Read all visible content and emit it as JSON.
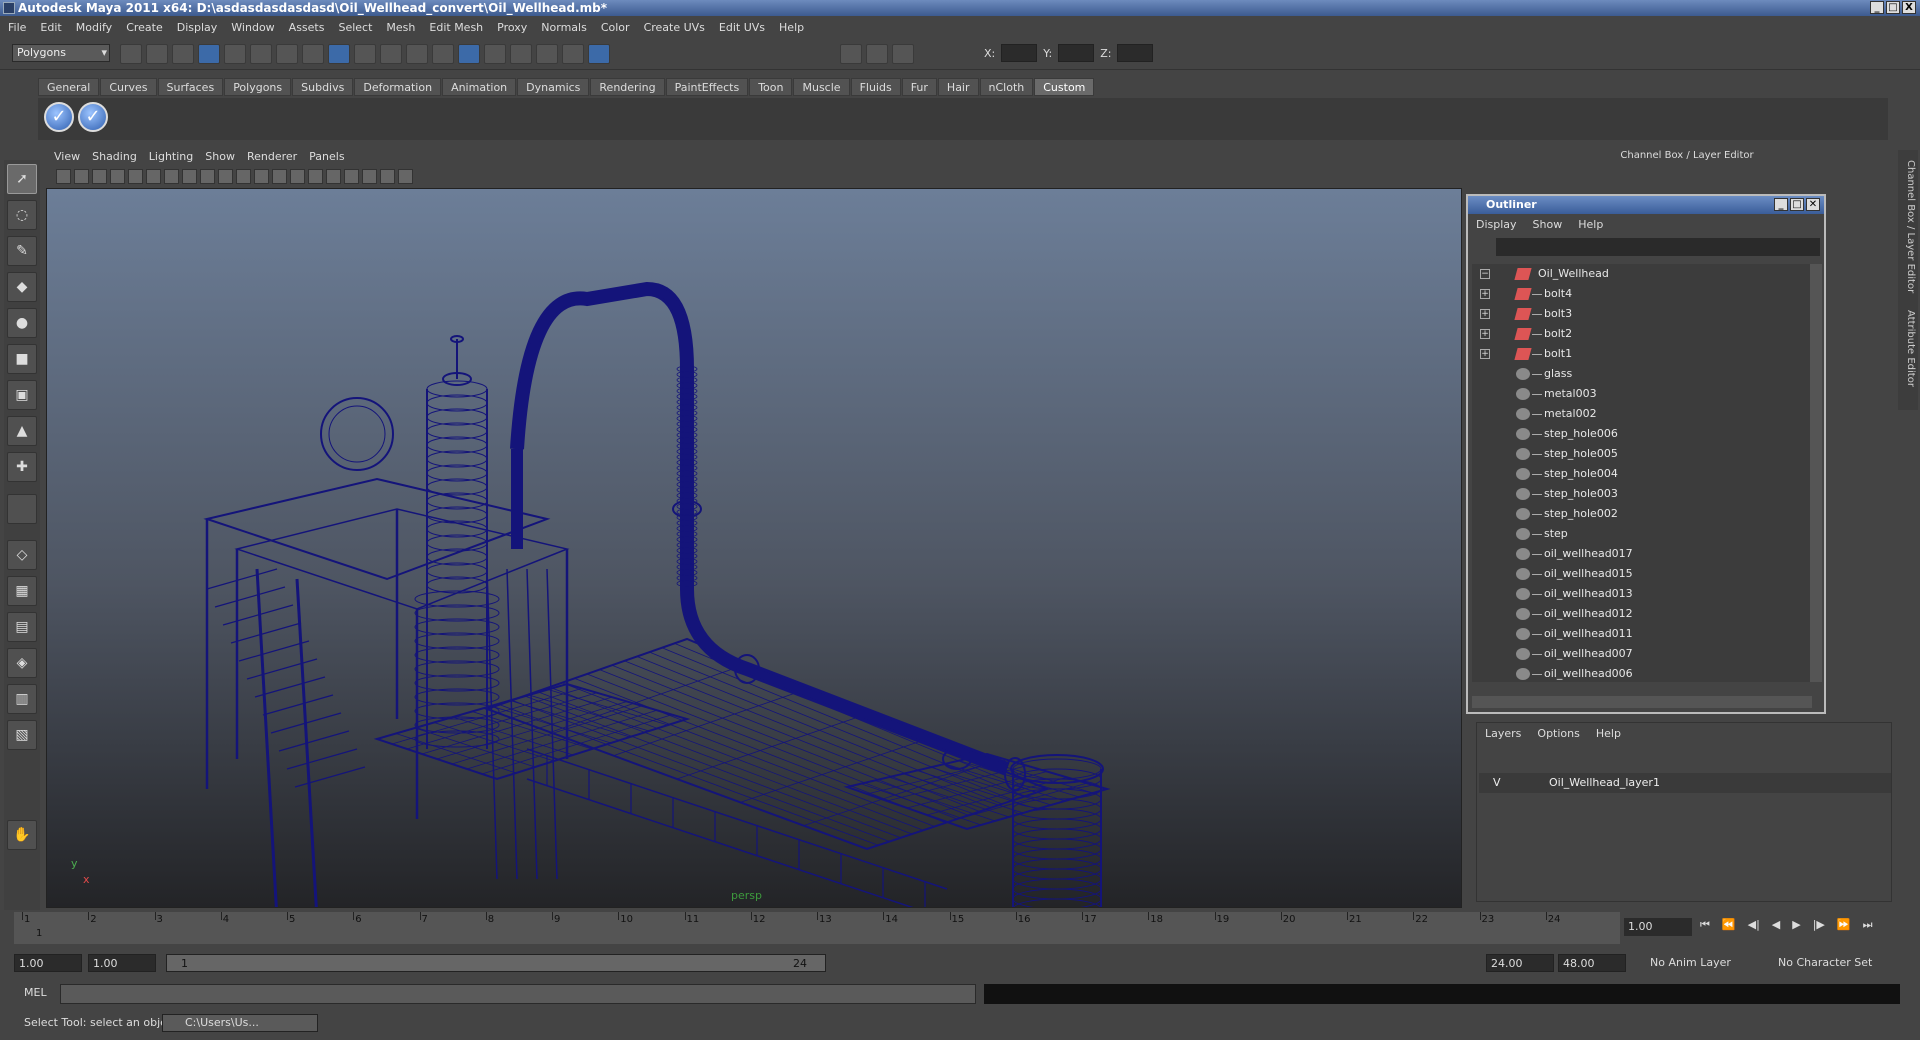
{
  "window": {
    "title": "Autodesk Maya 2011 x64: D:\\asdasdasdasdasd\\Oil_Wellhead_convert\\Oil_Wellhead.mb*",
    "buttons": [
      "_",
      "□",
      "X"
    ]
  },
  "menubar": [
    "File",
    "Edit",
    "Modify",
    "Create",
    "Display",
    "Window",
    "Assets",
    "Select",
    "Mesh",
    "Edit Mesh",
    "Proxy",
    "Normals",
    "Color",
    "Create UVs",
    "Edit UVs",
    "Help"
  ],
  "status_line": {
    "mode": "Polygons",
    "x_label": "X:",
    "y_label": "Y:",
    "z_label": "Z:"
  },
  "shelf_tabs": [
    "General",
    "Curves",
    "Surfaces",
    "Polygons",
    "Subdivs",
    "Deformation",
    "Animation",
    "Dynamics",
    "Rendering",
    "PaintEffects",
    "Toon",
    "Muscle",
    "Fluids",
    "Fur",
    "Hair",
    "nCloth",
    "Custom"
  ],
  "shelf_active": "Custom",
  "viewport": {
    "menu": [
      "View",
      "Shading",
      "Lighting",
      "Show",
      "Renderer",
      "Panels"
    ],
    "camera": "persp",
    "axis_y": "y",
    "axis_x": "x",
    "wire_color": "#14147a"
  },
  "channel_box": {
    "title": "Channel Box / Layer Editor",
    "side_tabs": [
      "Channel Box / Layer Editor",
      "Attribute Editor"
    ]
  },
  "outliner": {
    "title": "Outliner",
    "menu": [
      "Display",
      "Show",
      "Help"
    ],
    "items": [
      {
        "label": "Oil_Wellhead",
        "type": "group",
        "expander": "−",
        "root": true
      },
      {
        "label": "bolt4",
        "type": "group",
        "expander": "+"
      },
      {
        "label": "bolt3",
        "type": "group",
        "expander": "+"
      },
      {
        "label": "bolt2",
        "type": "group",
        "expander": "+"
      },
      {
        "label": "bolt1",
        "type": "group",
        "expander": "+"
      },
      {
        "label": "glass",
        "type": "mesh"
      },
      {
        "label": "metal003",
        "type": "mesh"
      },
      {
        "label": "metal002",
        "type": "mesh"
      },
      {
        "label": "step_hole006",
        "type": "mesh"
      },
      {
        "label": "step_hole005",
        "type": "mesh"
      },
      {
        "label": "step_hole004",
        "type": "mesh"
      },
      {
        "label": "step_hole003",
        "type": "mesh"
      },
      {
        "label": "step_hole002",
        "type": "mesh"
      },
      {
        "label": "step",
        "type": "mesh"
      },
      {
        "label": "oil_wellhead017",
        "type": "mesh"
      },
      {
        "label": "oil_wellhead015",
        "type": "mesh"
      },
      {
        "label": "oil_wellhead013",
        "type": "mesh"
      },
      {
        "label": "oil_wellhead012",
        "type": "mesh"
      },
      {
        "label": "oil_wellhead011",
        "type": "mesh"
      },
      {
        "label": "oil_wellhead007",
        "type": "mesh"
      },
      {
        "label": "oil_wellhead006",
        "type": "mesh"
      }
    ]
  },
  "layers": {
    "menu": [
      "Layers",
      "Options",
      "Help"
    ],
    "rows": [
      {
        "visible": "V",
        "name": "Oil_Wellhead_layer1"
      }
    ]
  },
  "time_slider": {
    "ticks": [
      "1",
      "2",
      "3",
      "4",
      "5",
      "6",
      "7",
      "8",
      "9",
      "10",
      "11",
      "12",
      "13",
      "14",
      "15",
      "16",
      "17",
      "18",
      "19",
      "20",
      "21",
      "22",
      "23",
      "24"
    ],
    "current_marker": "1",
    "current_time": "1.00"
  },
  "range_slider": {
    "start": "1.00",
    "playback_start": "1.00",
    "range_in": "1",
    "range_out": "24",
    "playback_end": "24.00",
    "end": "48.00",
    "anim_layer": "No Anim Layer",
    "character_set": "No Character Set"
  },
  "command_line": {
    "label": "MEL"
  },
  "help_line": {
    "text": "Select Tool: select an object",
    "task": "C:\\Users\\Us..."
  }
}
